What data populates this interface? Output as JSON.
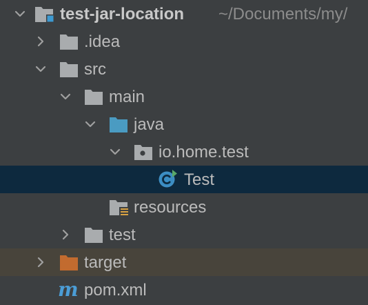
{
  "project_tree": {
    "root": {
      "label": "test-jar-location",
      "path": "~/Documents/my/"
    },
    "idea": {
      "label": ".idea"
    },
    "src": {
      "label": "src"
    },
    "main": {
      "label": "main"
    },
    "java": {
      "label": "java"
    },
    "package": {
      "label": "io.home.test"
    },
    "test_class": {
      "label": "Test"
    },
    "resources": {
      "label": "resources"
    },
    "test_dir": {
      "label": "test"
    },
    "target": {
      "label": "target"
    },
    "pom": {
      "label": "pom.xml"
    }
  },
  "colors": {
    "background": "#3c3f41",
    "selection": "#0d293e",
    "excluded_row": "#48443b",
    "folder": "#a9acae",
    "source_folder": "#4a9bc2",
    "excluded_folder": "#c26b2f",
    "maven": "#4b9dd6"
  },
  "icons": {
    "root": "project-module-icon",
    "idea": "folder-icon",
    "src": "folder-icon",
    "main": "folder-icon",
    "java": "source-folder-icon",
    "package": "package-icon",
    "test_class": "java-class-main-icon",
    "resources": "resources-folder-icon",
    "test_dir": "folder-icon",
    "target": "excluded-folder-icon",
    "pom": "maven-icon"
  }
}
